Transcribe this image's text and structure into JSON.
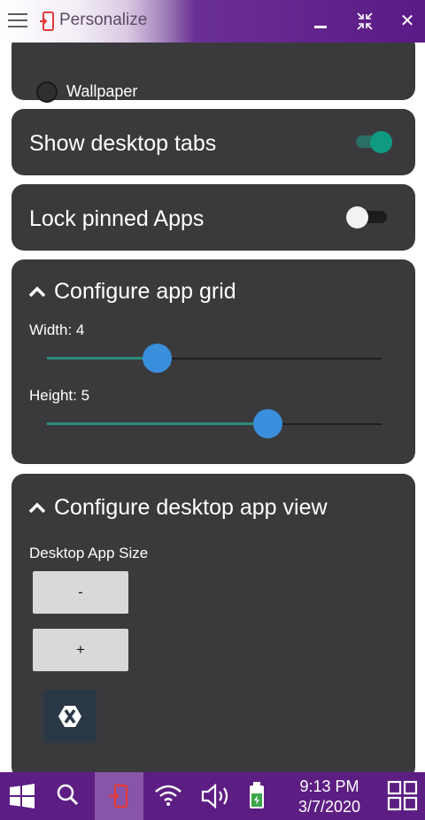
{
  "window": {
    "title": "Personalize",
    "close_glyph": "✕"
  },
  "cards": {
    "wallpaper_label": "Wallpaper",
    "show_desktop_tabs": {
      "label": "Show desktop tabs",
      "on": true
    },
    "lock_pinned_apps": {
      "label": "Lock pinned Apps",
      "on": false
    },
    "app_grid": {
      "title": "Configure app grid",
      "width_label": "Width: 4",
      "height_label": "Height: 5",
      "width_fraction": 0.33,
      "height_fraction": 0.66
    },
    "desktop_app_view": {
      "title": "Configure desktop app view",
      "size_label": "Desktop App Size",
      "minus": "-",
      "plus": "+"
    }
  },
  "taskbar": {
    "time": "9:13 PM",
    "date": "3/7/2020",
    "icons": [
      "windows-start-icon",
      "search-icon",
      "personalize-app-icon",
      "wifi-icon",
      "volume-icon",
      "battery-icon",
      "task-view-icon"
    ]
  },
  "colors": {
    "card_bg": "#3a3a3d",
    "accent_teal": "#0f9a82",
    "slider_knob": "#3a8fdc",
    "taskbar": "#5d1e83"
  }
}
